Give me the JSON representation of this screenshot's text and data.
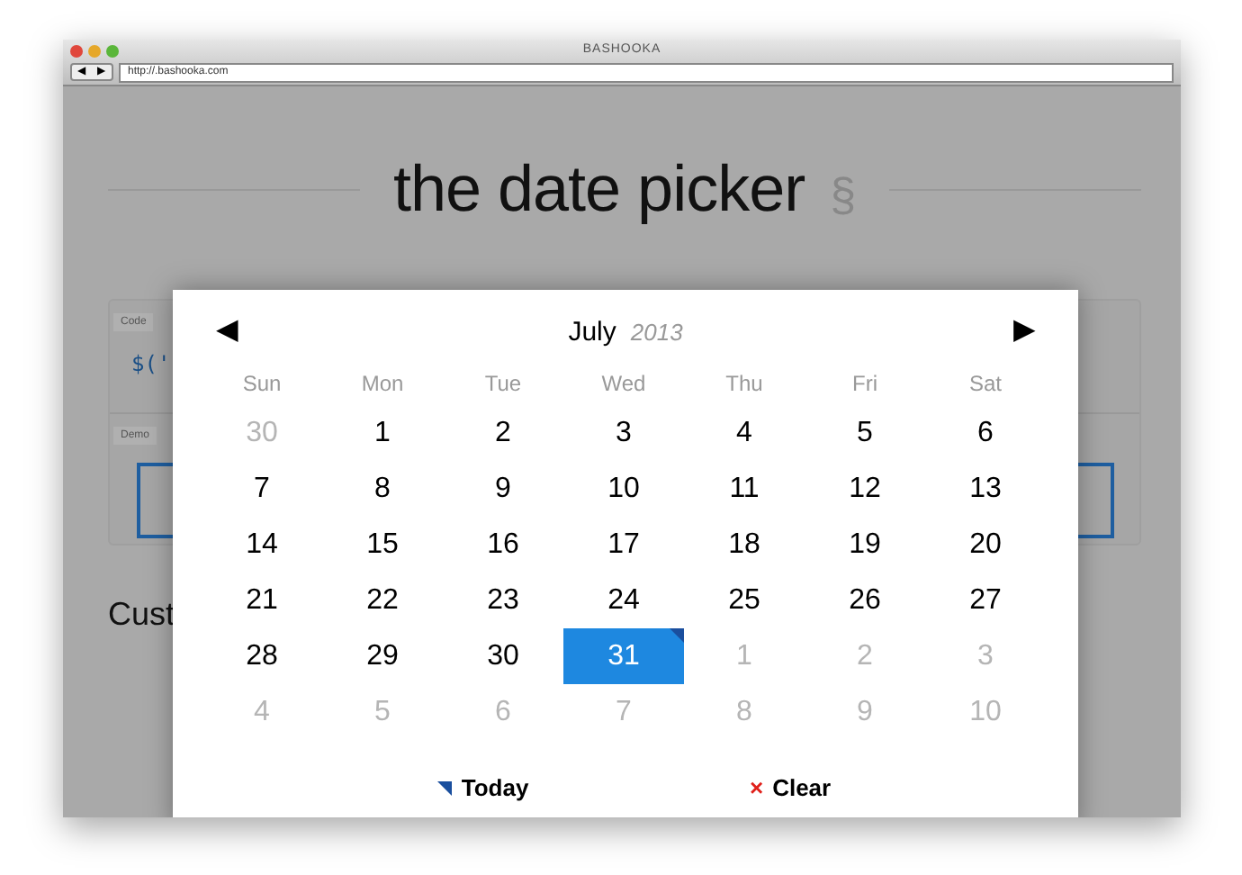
{
  "window": {
    "title": "BASHOOKA",
    "back": "◀",
    "forward": "▶",
    "address": "http://.bashooka.com"
  },
  "page": {
    "heading": "the date picker",
    "heading_mark": "§",
    "code_label": "Code",
    "code_text": "$('",
    "demo_label": "Demo",
    "section_heading": "Cust"
  },
  "date_picker": {
    "month": "July",
    "year": "2013",
    "prev": "◀",
    "next": "▶",
    "weekdays": [
      "Sun",
      "Mon",
      "Tue",
      "Wed",
      "Thu",
      "Fri",
      "Sat"
    ],
    "days": [
      {
        "label": "30",
        "outside": true,
        "selected": false,
        "today": false
      },
      {
        "label": "1",
        "outside": false,
        "selected": false,
        "today": false
      },
      {
        "label": "2",
        "outside": false,
        "selected": false,
        "today": false
      },
      {
        "label": "3",
        "outside": false,
        "selected": false,
        "today": false
      },
      {
        "label": "4",
        "outside": false,
        "selected": false,
        "today": false
      },
      {
        "label": "5",
        "outside": false,
        "selected": false,
        "today": false
      },
      {
        "label": "6",
        "outside": false,
        "selected": false,
        "today": false
      },
      {
        "label": "7",
        "outside": false,
        "selected": false,
        "today": false
      },
      {
        "label": "8",
        "outside": false,
        "selected": false,
        "today": false
      },
      {
        "label": "9",
        "outside": false,
        "selected": false,
        "today": false
      },
      {
        "label": "10",
        "outside": false,
        "selected": false,
        "today": false
      },
      {
        "label": "11",
        "outside": false,
        "selected": false,
        "today": false
      },
      {
        "label": "12",
        "outside": false,
        "selected": false,
        "today": false
      },
      {
        "label": "13",
        "outside": false,
        "selected": false,
        "today": false
      },
      {
        "label": "14",
        "outside": false,
        "selected": false,
        "today": false
      },
      {
        "label": "15",
        "outside": false,
        "selected": false,
        "today": false
      },
      {
        "label": "16",
        "outside": false,
        "selected": false,
        "today": false
      },
      {
        "label": "17",
        "outside": false,
        "selected": false,
        "today": false
      },
      {
        "label": "18",
        "outside": false,
        "selected": false,
        "today": false
      },
      {
        "label": "19",
        "outside": false,
        "selected": false,
        "today": false
      },
      {
        "label": "20",
        "outside": false,
        "selected": false,
        "today": false
      },
      {
        "label": "21",
        "outside": false,
        "selected": false,
        "today": false
      },
      {
        "label": "22",
        "outside": false,
        "selected": false,
        "today": false
      },
      {
        "label": "23",
        "outside": false,
        "selected": false,
        "today": false
      },
      {
        "label": "24",
        "outside": false,
        "selected": false,
        "today": false
      },
      {
        "label": "25",
        "outside": false,
        "selected": false,
        "today": false
      },
      {
        "label": "26",
        "outside": false,
        "selected": false,
        "today": false
      },
      {
        "label": "27",
        "outside": false,
        "selected": false,
        "today": false
      },
      {
        "label": "28",
        "outside": false,
        "selected": false,
        "today": false
      },
      {
        "label": "29",
        "outside": false,
        "selected": false,
        "today": false
      },
      {
        "label": "30",
        "outside": false,
        "selected": false,
        "today": false
      },
      {
        "label": "31",
        "outside": false,
        "selected": true,
        "today": true
      },
      {
        "label": "1",
        "outside": true,
        "selected": false,
        "today": false
      },
      {
        "label": "2",
        "outside": true,
        "selected": false,
        "today": false
      },
      {
        "label": "3",
        "outside": true,
        "selected": false,
        "today": false
      },
      {
        "label": "4",
        "outside": true,
        "selected": false,
        "today": false
      },
      {
        "label": "5",
        "outside": true,
        "selected": false,
        "today": false
      },
      {
        "label": "6",
        "outside": true,
        "selected": false,
        "today": false
      },
      {
        "label": "7",
        "outside": true,
        "selected": false,
        "today": false
      },
      {
        "label": "8",
        "outside": true,
        "selected": false,
        "today": false
      },
      {
        "label": "9",
        "outside": true,
        "selected": false,
        "today": false
      },
      {
        "label": "10",
        "outside": true,
        "selected": false,
        "today": false
      }
    ],
    "today_button": "Today",
    "clear_button": "Clear",
    "clear_icon": "×"
  }
}
